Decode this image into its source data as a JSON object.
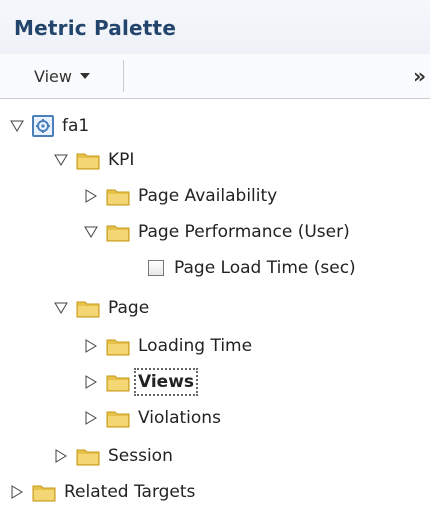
{
  "panel": {
    "title": "Metric Palette",
    "toolbar": {
      "view_label": "View",
      "overflow_label": "»"
    }
  },
  "tree": {
    "root": {
      "label": "fa1",
      "expanded": true
    },
    "kpi": {
      "label": "KPI",
      "expanded": true
    },
    "page_availability": {
      "label": "Page Availability",
      "expanded": false
    },
    "page_performance": {
      "label": "Page Performance (User)",
      "expanded": true
    },
    "page_load_time": {
      "label": "Page Load Time (sec)",
      "checked": false
    },
    "page": {
      "label": "Page",
      "expanded": true
    },
    "loading_time": {
      "label": "Loading Time",
      "expanded": false
    },
    "views": {
      "label": "Views",
      "expanded": false,
      "selected": true
    },
    "violations": {
      "label": "Violations",
      "expanded": false
    },
    "session": {
      "label": "Session",
      "expanded": false
    },
    "related_targets": {
      "label": "Related Targets",
      "expanded": false
    }
  },
  "colors": {
    "title": "#23456b",
    "folder": "#e6c24a",
    "folder_dark": "#c59a1a",
    "root_icon": "#4a7fb8"
  }
}
